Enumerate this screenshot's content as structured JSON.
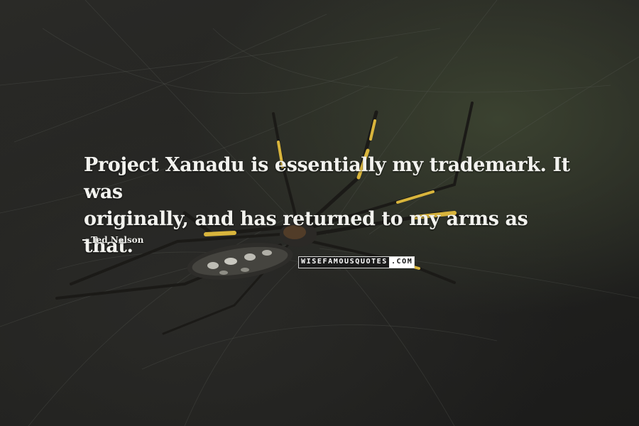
{
  "quote": {
    "line1": "Project Xanadu is essentially my trademark. It was",
    "line2": "originally, and has returned to my arms as that."
  },
  "author": {
    "name": "Ted Nelson"
  },
  "watermark": {
    "left": "WISEFAMOUSQUOTES",
    "right": ".COM"
  },
  "colors": {
    "background": "#1f1f1d",
    "text": "#f2f2ee",
    "spider_band": "#d9b53c"
  }
}
